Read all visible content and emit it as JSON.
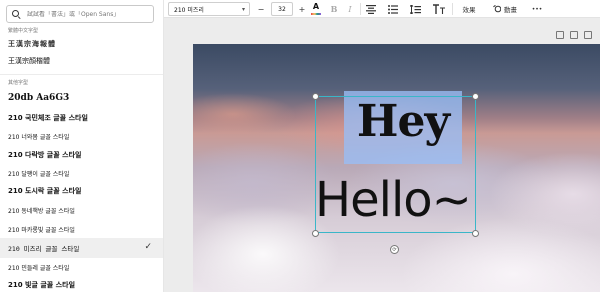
{
  "search": {
    "placeholder": "試試看「書法」或「Open Sans」"
  },
  "sections": {
    "chinese": "繁體中文字型",
    "other": "其他字型"
  },
  "fonts": [
    {
      "label": "王漢宗海報體",
      "style": "outline"
    },
    {
      "label": "王漢宗顏楷體",
      "style": "serif"
    },
    {
      "label": "20db Aa6G3",
      "style": "black"
    },
    {
      "label": "210 국민체조 글꼴 스타일",
      "style": "bold"
    },
    {
      "label": "210 너와봄 글꼴 스타일",
      "style": "light"
    },
    {
      "label": "210 다락방 글꼴 스타일",
      "style": "bold"
    },
    {
      "label": "210 달팽이 글꼴 스타일",
      "style": "light"
    },
    {
      "label": "210 도시락 글꼴 스타일",
      "style": "bold"
    },
    {
      "label": "210 동네책방 글꼴 스타일",
      "style": "light"
    },
    {
      "label": "210 마카롱빛 글꼴 스타일",
      "style": "light"
    },
    {
      "label": "210 미즈리 글꼴 스타일",
      "style": "mono"
    },
    {
      "label": "210 민들레 글꼴 스타일",
      "style": "light"
    },
    {
      "label": "210 빛글 글꼴 스타일",
      "style": "bold"
    }
  ],
  "selected_font": "210 미즈리 글꼴 스타일",
  "toolbar": {
    "font_name": "210 미즈리",
    "font_size": "32",
    "minus": "−",
    "plus": "+",
    "color_letter": "A",
    "bold": "B",
    "italic": "I",
    "effects": "效果",
    "animate": "動畫",
    "more": "•••"
  },
  "canvas": {
    "hey_text": "Hey",
    "hello_text": "Hello~"
  }
}
